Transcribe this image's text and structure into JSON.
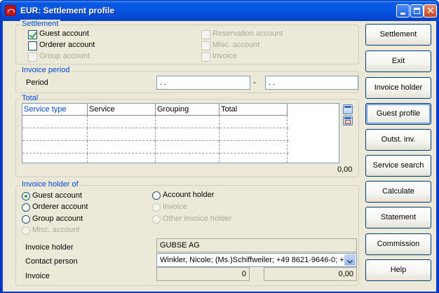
{
  "window": {
    "title": "EUR: Settlement profile"
  },
  "settlement": {
    "legend": "Settlement",
    "items": [
      {
        "label": "Guest account",
        "checked": true,
        "enabled": true
      },
      {
        "label": "Orderer account",
        "checked": false,
        "enabled": true
      },
      {
        "label": "Group account",
        "checked": false,
        "enabled": false
      },
      {
        "label": "Reservation account",
        "checked": false,
        "enabled": false
      },
      {
        "label": "Misc. account",
        "checked": false,
        "enabled": false
      },
      {
        "label": "Invoice",
        "checked": false,
        "enabled": false
      }
    ]
  },
  "invoice_period": {
    "legend": "Invoice period",
    "label": "Period",
    "from": " .  .",
    "separator": "-",
    "to": " .  ."
  },
  "total": {
    "legend": "Total",
    "columns": [
      "Service type",
      "Service",
      "Grouping",
      "Total"
    ],
    "sum": "0,00"
  },
  "invoice_holder_of": {
    "legend": "Invoice holder of",
    "options": [
      {
        "label": "Guest account",
        "selected": true,
        "enabled": true
      },
      {
        "label": "Orderer account",
        "selected": false,
        "enabled": true
      },
      {
        "label": "Group account",
        "selected": false,
        "enabled": true
      },
      {
        "label": "Misc. account",
        "selected": false,
        "enabled": false
      },
      {
        "label": "Account holder",
        "selected": false,
        "enabled": true
      },
      {
        "label": "Invoice",
        "selected": false,
        "enabled": false
      },
      {
        "label": "Other invoice holder",
        "selected": false,
        "enabled": false
      }
    ],
    "invoice_holder_label": "Invoice holder",
    "invoice_holder_value": "GUBSE AG",
    "contact_label": "Contact person",
    "contact_value": "Winkler, Nicole;  (Ms.)Schiffweiler; +49 8621-9646-0; +",
    "invoice_label": "Invoice",
    "invoice_count": "0",
    "invoice_amount": "0,00"
  },
  "buttons": {
    "settlement": "Settlement",
    "exit": "Exit",
    "invoice_holder": "Invoice holder",
    "guest_profile": "Guest profile",
    "outst_inv": "Outst. inv.",
    "service_search": "Service search",
    "calculate": "Calculate",
    "statement": "Statement",
    "commission": "Commission",
    "help": "Help"
  },
  "colors": {
    "accent": "#0046d5",
    "titlebar": "#0754e0",
    "face": "#ece9d8"
  }
}
